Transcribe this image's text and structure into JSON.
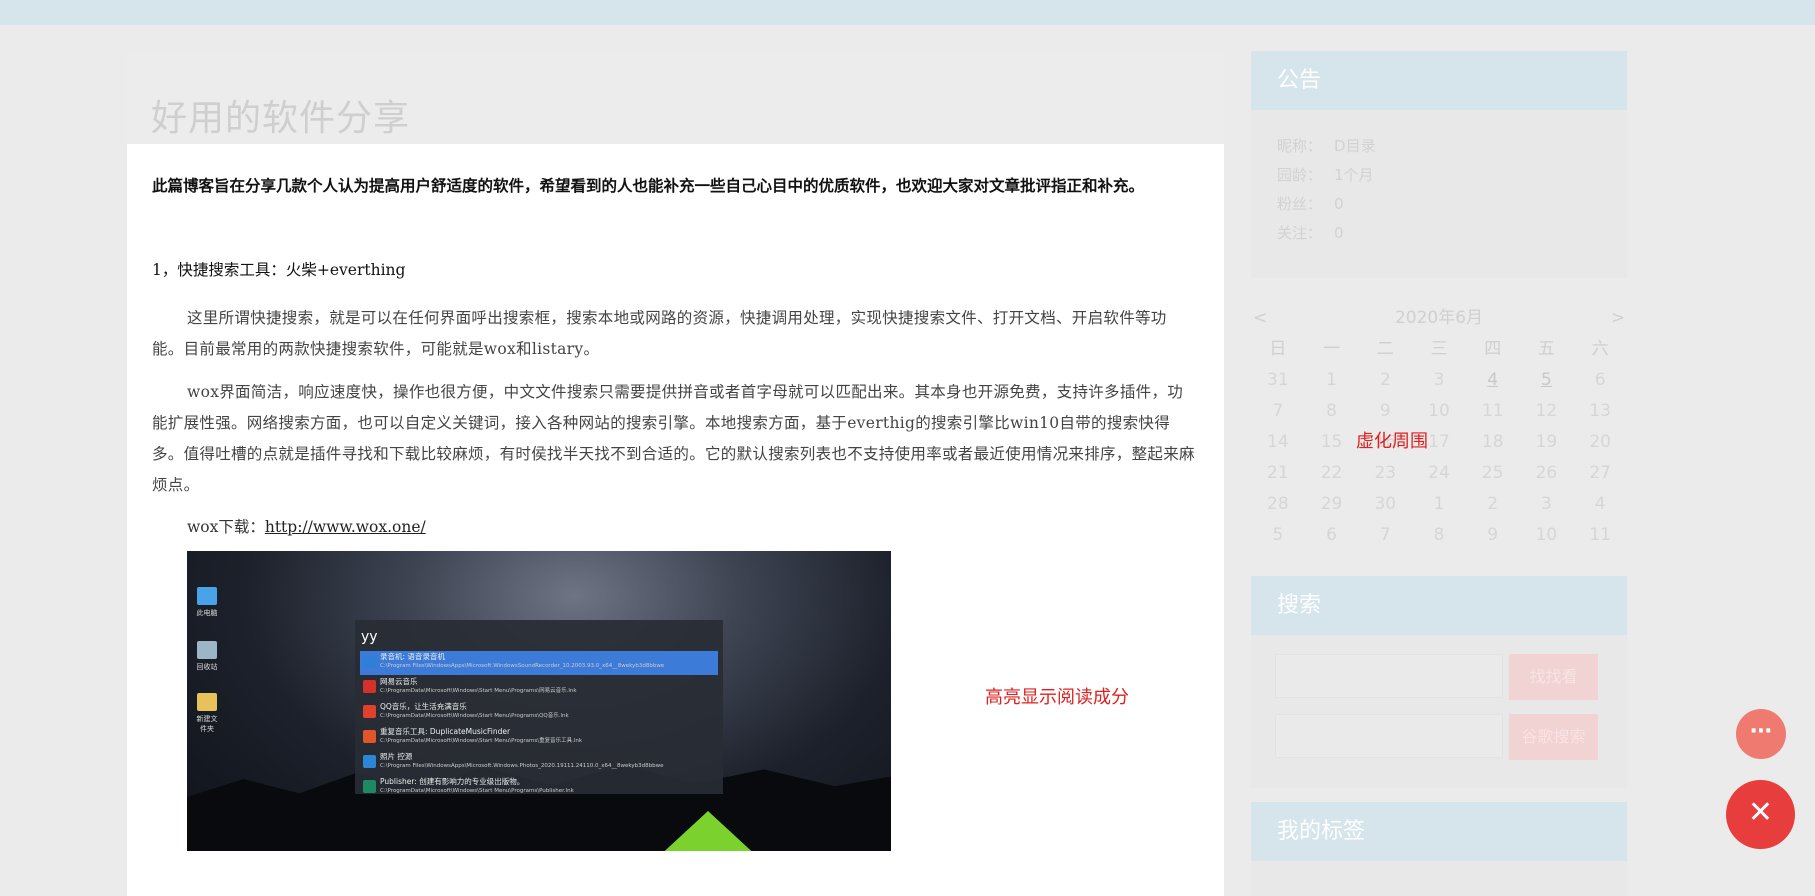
{
  "article": {
    "title": "好用的软件分享",
    "intro": "此篇博客旨在分享几款个人认为提高用户舒适度的软件，希望看到的人也能补充一些自己心目中的优质软件，也欢迎大家对文章批评指正和补充。",
    "section1_heading": "1，快捷搜索工具：火柴+everthing",
    "para1": "这里所谓快捷搜索，就是可以在任何界面呼出搜索框，搜索本地或网路的资源，快捷调用处理，实现快捷搜索文件、打开文档、开启软件等功能。目前最常用的两款快捷搜索软件，可能就是wox和listary。",
    "para2": "wox界面简洁，响应速度快，操作也很方便，中文文件搜索只需要提供拼音或者首字母就可以匹配出来。其本身也开源免费，支持许多插件，功能扩展性强。网络搜索方面，也可以自定义关键词，接入各种网站的搜索引擎。本地搜索方面，基于everthig的搜索引擎比win10自带的搜索快得多。值得吐槽的点就是插件寻找和下载比较麻烦，有时侯找半天找不到合适的。它的默认搜索列表也不支持使用率或者最近使用情况来排序，整起来麻烦点。",
    "download_label": "wox下载：",
    "download_link": "http://www.wox.one/"
  },
  "screenshot": {
    "desktop_icons": [
      {
        "label": "此电脑",
        "color": "#4aa3e8"
      },
      {
        "label": "回收站",
        "color": "#9cb6c8"
      },
      {
        "label": "新建文件夹",
        "color": "#e8c15a"
      }
    ],
    "query": "yy",
    "results": [
      {
        "title": "录音机: 语音录音机",
        "path": "C:\\Program Files\\WindowsApps\\Microsoft.WindowsSoundRecorder_10.2003.93.0_x64__8wekyb3d8bbwe",
        "icon_color": "#2f7fd8",
        "selected": true
      },
      {
        "title": "网易云音乐",
        "path": "C:\\ProgramData\\Microsoft\\Windows\\Start Menu\\Programs\\网易云音乐.lnk",
        "icon_color": "#d6302b",
        "selected": false
      },
      {
        "title": "QQ音乐，让生活充满音乐",
        "path": "C:\\ProgramData\\Microsoft\\Windows\\Start Menu\\Programs\\QQ音乐.lnk",
        "icon_color": "#e2402e",
        "selected": false
      },
      {
        "title": "重复音乐工具: DuplicateMusicFinder",
        "path": "C:\\ProgramData\\Microsoft\\Windows\\Start Menu\\Programs\\重复音乐工具.lnk",
        "icon_color": "#e0552a",
        "selected": false
      },
      {
        "title": "照片 控源",
        "path": "C:\\Program Files\\WindowsApps\\Microsoft.Windows.Photos_2020.19111.24110.0_x64__8wekyb3d8bbwe",
        "icon_color": "#2b86d6",
        "selected": false
      },
      {
        "title": "Publisher: 创建有影响力的专业级出版物。",
        "path": "C:\\ProgramData\\Microsoft\\Windows\\Start Menu\\Programs\\Publisher.lnk",
        "icon_color": "#1e8a63",
        "selected": false
      }
    ]
  },
  "annotations": {
    "highlight": "高亮显示阅读成分",
    "virtualize": "虚化周围"
  },
  "sidebar": {
    "notice": {
      "title": "公告",
      "rows": [
        {
          "label": "昵称：",
          "value": "D目录"
        },
        {
          "label": "园龄：",
          "value": "1个月"
        },
        {
          "label": "粉丝：",
          "value": "0"
        },
        {
          "label": "关注：",
          "value": "0"
        }
      ]
    },
    "calendar": {
      "prev": "<",
      "next": ">",
      "month": "2020年6月",
      "weekdays": [
        "日",
        "一",
        "二",
        "三",
        "四",
        "五",
        "六"
      ],
      "weeks": [
        [
          "31",
          "1",
          "2",
          "3",
          "4",
          "5",
          "6"
        ],
        [
          "7",
          "8",
          "9",
          "10",
          "11",
          "12",
          "13"
        ],
        [
          "14",
          "15",
          "16",
          "17",
          "18",
          "19",
          "20"
        ],
        [
          "21",
          "22",
          "23",
          "24",
          "25",
          "26",
          "27"
        ],
        [
          "28",
          "29",
          "30",
          "1",
          "2",
          "3",
          "4"
        ],
        [
          "5",
          "6",
          "7",
          "8",
          "9",
          "10",
          "11"
        ]
      ],
      "linked_days": [
        "4",
        "5"
      ]
    },
    "search": {
      "title": "搜索",
      "button1": "找找看",
      "button2": "谷歌搜索"
    },
    "tags": {
      "title": "我的标签"
    }
  },
  "fab": {
    "more_icon": "⋯",
    "close_icon": "✕"
  }
}
